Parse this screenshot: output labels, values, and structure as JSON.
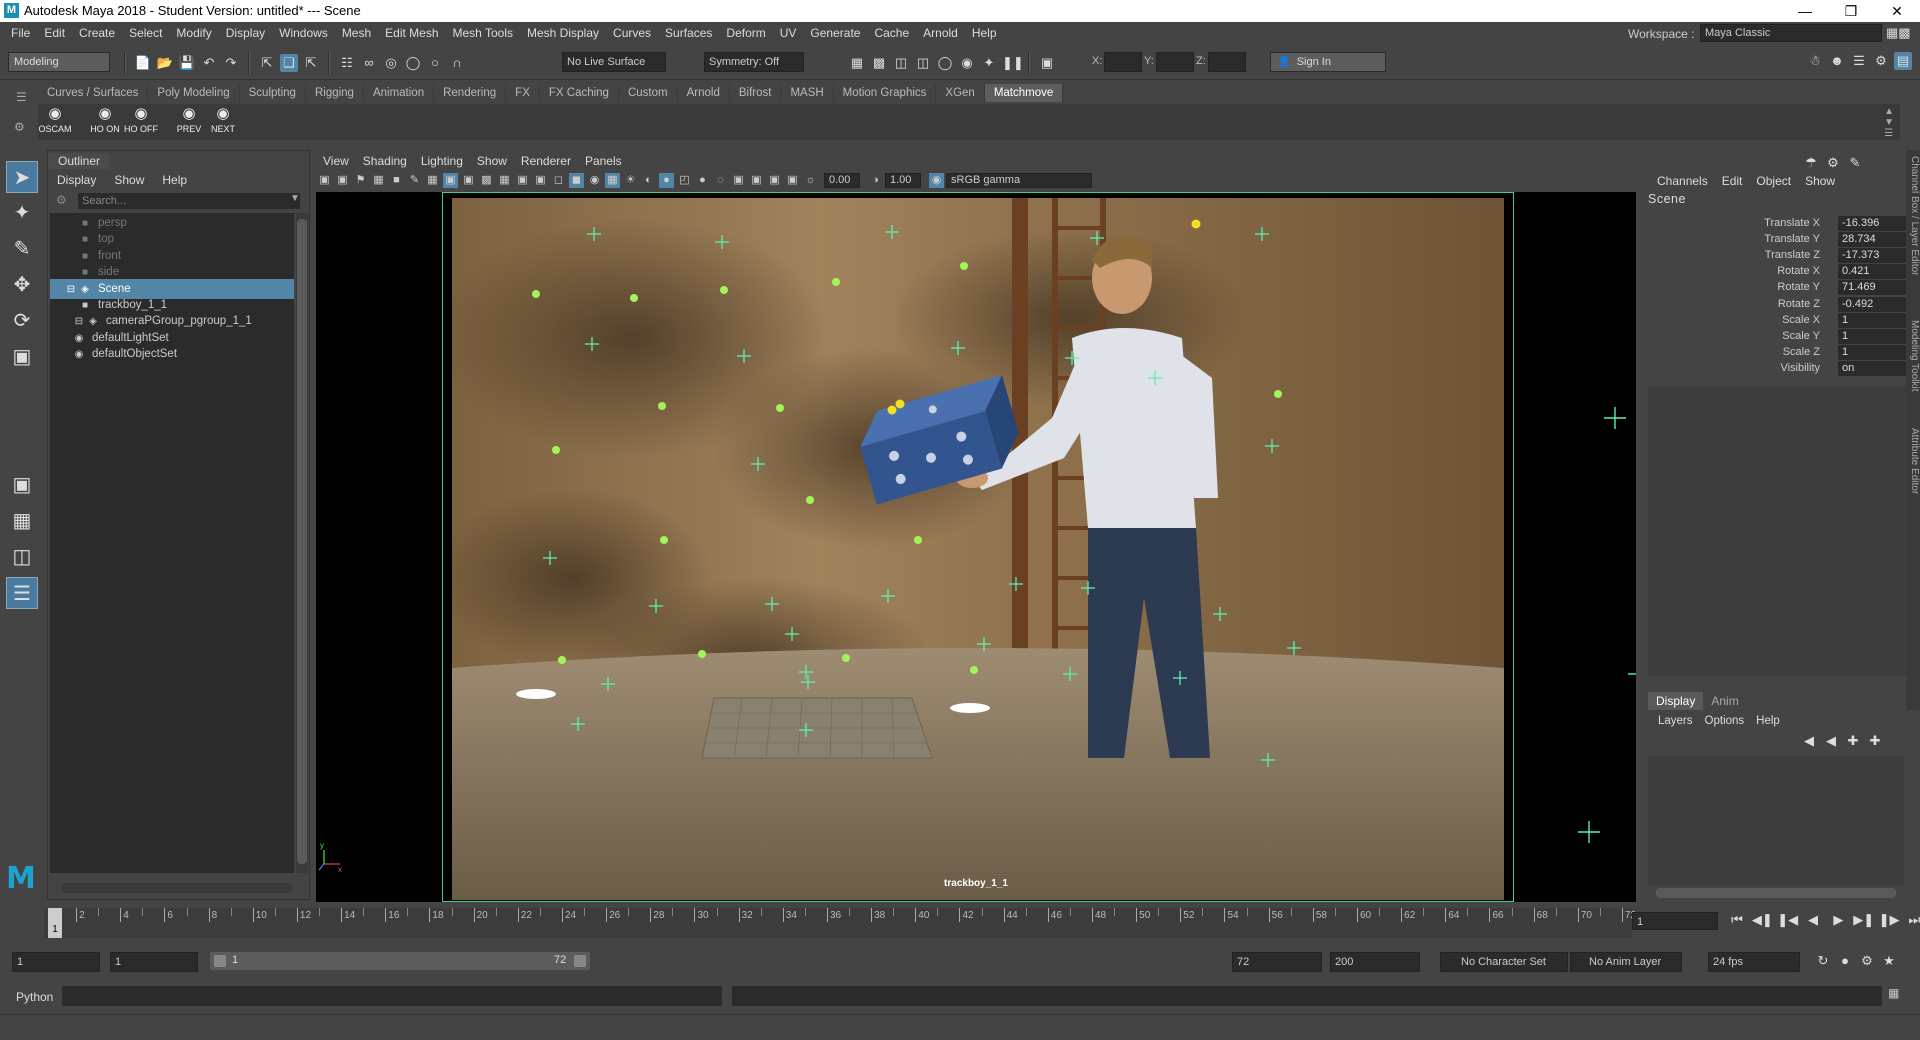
{
  "window": {
    "title": "Autodesk Maya 2018 - Student Version: untitled*   ---   Scene"
  },
  "menubar": {
    "items": [
      "File",
      "Edit",
      "Create",
      "Select",
      "Modify",
      "Display",
      "Windows",
      "Mesh",
      "Edit Mesh",
      "Mesh Tools",
      "Mesh Display",
      "Curves",
      "Surfaces",
      "Deform",
      "UV",
      "Generate",
      "Cache",
      "Arnold",
      "Help"
    ],
    "workspace_label": "Workspace :",
    "workspace_value": "Maya Classic"
  },
  "statusline": {
    "menuset": "Modeling",
    "live_surface": "No Live Surface",
    "symmetry": "Symmetry: Off",
    "x_label": "X:",
    "y_label": "Y:",
    "z_label": "Z:",
    "sign_in": "Sign In"
  },
  "shelf": {
    "tabs": [
      "Curves / Surfaces",
      "Poly Modeling",
      "Sculpting",
      "Rigging",
      "Animation",
      "Rendering",
      "FX",
      "FX Caching",
      "Custom",
      "Arnold",
      "Bifrost",
      "MASH",
      "Motion Graphics",
      "XGen",
      "Matchmove"
    ],
    "active_tab": "Matchmove",
    "buttons": [
      "OSCAM",
      "HO ON",
      "HO OFF",
      "PREV",
      "NEXT"
    ]
  },
  "outliner": {
    "title": "Outliner",
    "menu": [
      "Display",
      "Show",
      "Help"
    ],
    "search_placeholder": "Search...",
    "items": [
      {
        "label": "persp",
        "indent": 1,
        "dim": true,
        "icon": "camera-icon"
      },
      {
        "label": "top",
        "indent": 1,
        "dim": true,
        "icon": "camera-icon"
      },
      {
        "label": "front",
        "indent": 1,
        "dim": true,
        "icon": "camera-icon"
      },
      {
        "label": "side",
        "indent": 1,
        "dim": true,
        "icon": "camera-icon"
      },
      {
        "label": "Scene",
        "indent": 0,
        "selected": true,
        "icon": "group-icon"
      },
      {
        "label": "trackboy_1_1",
        "indent": 1,
        "icon": "camera-icon"
      },
      {
        "label": "cameraPGroup_pgroup_1_1",
        "indent": 1,
        "icon": "group-icon"
      },
      {
        "label": "defaultLightSet",
        "indent": 0,
        "icon": "set-icon"
      },
      {
        "label": "defaultObjectSet",
        "indent": 0,
        "icon": "set-icon"
      }
    ]
  },
  "viewport": {
    "menu": [
      "View",
      "Shading",
      "Lighting",
      "Show",
      "Renderer",
      "Panels"
    ],
    "exposure": "0.00",
    "gamma": "1.00",
    "color_space": "sRGB gamma",
    "camera_label": "trackboy_1_1"
  },
  "channelbox": {
    "menu": [
      "Channels",
      "Edit",
      "Object",
      "Show"
    ],
    "object": "Scene",
    "attrs": [
      {
        "name": "Translate X",
        "value": "-16.396"
      },
      {
        "name": "Translate Y",
        "value": "28.734"
      },
      {
        "name": "Translate Z",
        "value": "-17.373"
      },
      {
        "name": "Rotate X",
        "value": "0.421"
      },
      {
        "name": "Rotate Y",
        "value": "71.469"
      },
      {
        "name": "Rotate Z",
        "value": "-0.492"
      },
      {
        "name": "Scale X",
        "value": "1"
      },
      {
        "name": "Scale Y",
        "value": "1"
      },
      {
        "name": "Scale Z",
        "value": "1"
      },
      {
        "name": "Visibility",
        "value": "on"
      }
    ],
    "side_tabs": [
      "Channel Box / Layer Editor",
      "Modeling Toolkit",
      "Attribute Editor"
    ]
  },
  "layer_editor": {
    "tabs": [
      "Display",
      "Anim"
    ],
    "active_tab": "Display",
    "menu": [
      "Layers",
      "Options",
      "Help"
    ]
  },
  "timeline": {
    "start": 1,
    "end": 72,
    "current_frame": "1",
    "current_marker": "1"
  },
  "range": {
    "start": "1",
    "inner_start": "1",
    "bar_start": "1",
    "bar_end": "72",
    "end": "72",
    "total_end": "200",
    "character_set": "No Character Set",
    "anim_layer": "No Anim Layer",
    "fps": "24 fps"
  },
  "command": {
    "language": "Python"
  }
}
